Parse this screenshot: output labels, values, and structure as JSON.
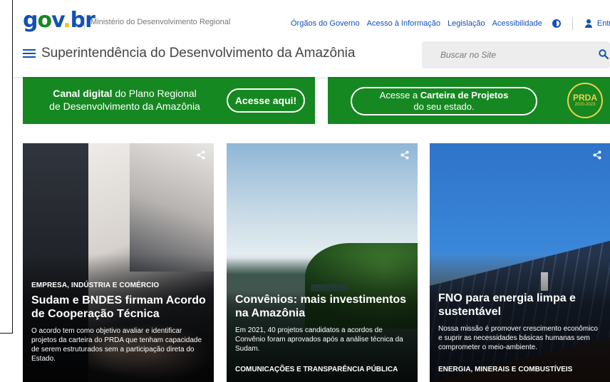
{
  "header": {
    "logo": {
      "g": "g",
      "o": "o",
      "v": "v",
      "dot": ".",
      "br": "br"
    },
    "ministry": "Ministério do Desenvolvimento Regional",
    "links": [
      "Órgãos do Governo",
      "Acesso à Informação",
      "Legislação",
      "Acessibilidade"
    ],
    "login_label": "Entra",
    "site_title": "Superintendência do Desenvolvimento da Amazônia",
    "search_placeholder": "Buscar no Site"
  },
  "banners": {
    "left": {
      "line1_a": "Canal digital",
      "line1_b": " do Plano Regional",
      "line2": "de Desenvolvimento da Amazônia",
      "button": "Acesse aqui!"
    },
    "right": {
      "pill_a": "Acesse a ",
      "pill_b": "Carteira de Projetos",
      "pill_c": "do seu estado.",
      "badge_name": "PRDA",
      "badge_years": "2020-2023"
    }
  },
  "cards": [
    {
      "tag": "EMPRESA, INDÚSTRIA E COMÉRCIO",
      "title": "Sudam e BNDES firmam Acordo de Cooperação Técnica",
      "desc": "O acordo tem como objetivo avaliar e identificar projetos da carteira do PRDA que tenham capacidade de serem estruturados sem a participação direta do Estado.",
      "footer": ""
    },
    {
      "tag": "",
      "title": "Convênios: mais investimentos na Amazônia",
      "desc": "Em 2021, 40 projetos candidatos a acordos de Convênio foram aprovados após a análise técnica da Sudam.",
      "footer": "COMUNICAÇÕES E TRANSPARÊNCIA PÚBLICA"
    },
    {
      "tag": "",
      "title": "FNO para energia limpa e sustentável",
      "desc": "Nossa missão é promover crescimento econômico e suprir as necessidades básicas humanas sem comprometer o meio-ambiente.",
      "footer": "ENERGIA, MINERAIS E COMBUSTÍVEIS"
    }
  ],
  "colors": {
    "brand_blue": "#1351b4",
    "banner_green": "#168821",
    "prda_gold": "#f2d14a"
  },
  "icons": {
    "menu": "hamburger-icon",
    "search": "search-icon",
    "contrast": "contrast-icon",
    "user": "user-icon",
    "share": "share-icon"
  }
}
